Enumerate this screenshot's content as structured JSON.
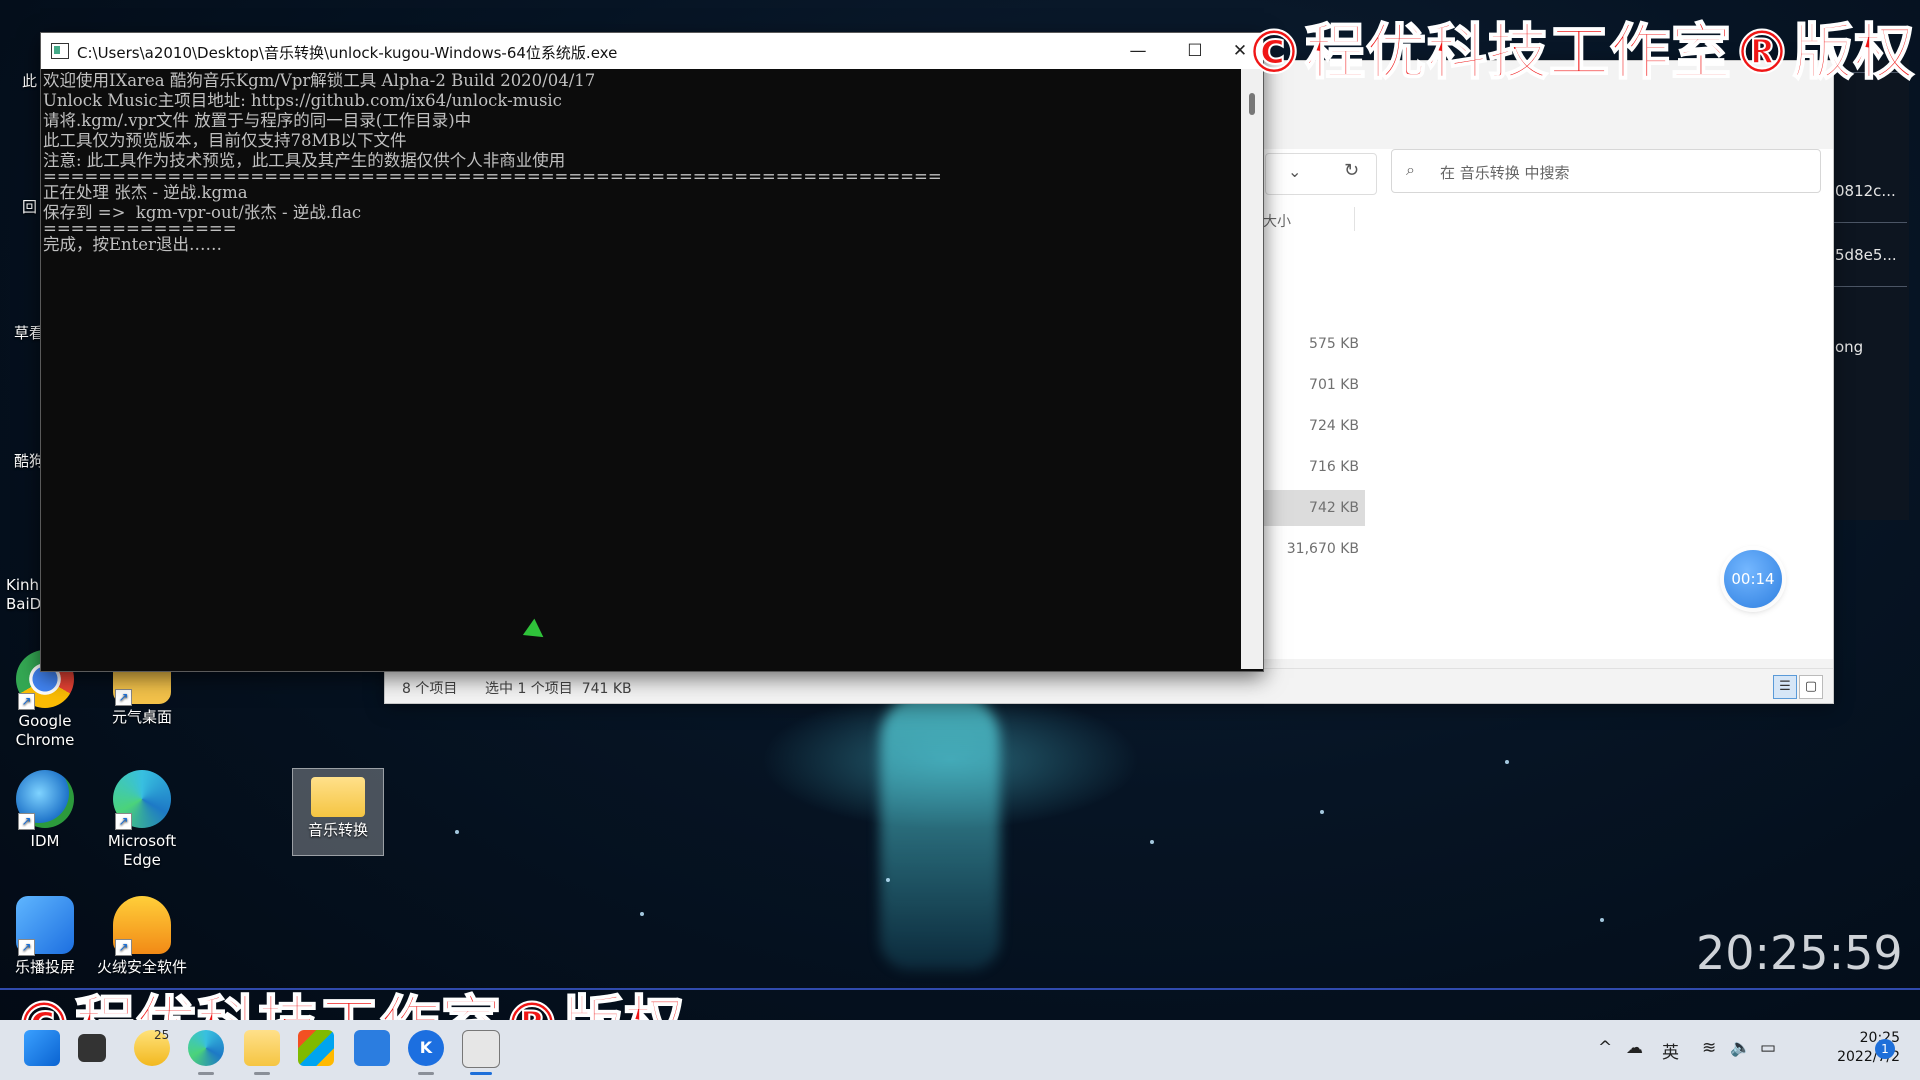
{
  "console": {
    "title": "C:\\Users\\a2010\\Desktop\\音乐转换\\unlock-kugou-Windows-64位系统版.exe",
    "lines": [
      "欢迎使用IXarea 酷狗音乐Kgm/Vpr解锁工具 Alpha-2 Build 2020/04/17",
      "Unlock Music主项目地址: https://github.com/ix64/unlock-music",
      "请将.kgm/.vpr文件 放置于与程序的同一目录(工作目录)中",
      "此工具仅为预览版本，目前仅支持78MB以下文件",
      "注意: 此工具作为技术预览，此工具及其产生的数据仅供个人非商业使用",
      "=================================================================",
      "正在处理 张杰 - 逆战.kgma",
      "保存到 =>  kgm-vpr-out/张杰 - 逆战.flac",
      "==============",
      "完成，按Enter退出……"
    ],
    "minimize_glyph": "—",
    "maximize_glyph": "☐",
    "close_glyph": "✕"
  },
  "explorer": {
    "search_placeholder": "在 音乐转换 中搜索",
    "column_size": "大小",
    "sizes": [
      "575 KB",
      "701 KB",
      "724 KB",
      "716 KB",
      "742 KB",
      "31,670 KB"
    ],
    "selected_index": 4,
    "status_items": "8 个项目",
    "status_selected": "选中 1 个项目  741 KB",
    "timer": "00:14"
  },
  "right_window": {
    "texts": [
      "0812c...",
      "5d8e5...",
      "ong"
    ]
  },
  "desktop": {
    "icons": [
      {
        "label": "Google\nChrome"
      },
      {
        "label": "元气桌面"
      },
      {
        "label": "IDM"
      },
      {
        "label": "Microsoft\nEdge"
      },
      {
        "label": "音乐转换"
      },
      {
        "label": "乐播投屏"
      },
      {
        "label": "火绒安全软件"
      }
    ],
    "partial_labels": [
      "此",
      "回",
      "草看",
      "酷狗",
      "Kinh\nBaiD"
    ]
  },
  "watermark": "©程优科技工作室®版权",
  "big_clock": "20:25:59",
  "taskbar": {
    "tray_chevron": "^",
    "ime": "英",
    "time": "20:25",
    "date": "2022/7/2",
    "notification_count": "1",
    "weather_temp": "25"
  }
}
